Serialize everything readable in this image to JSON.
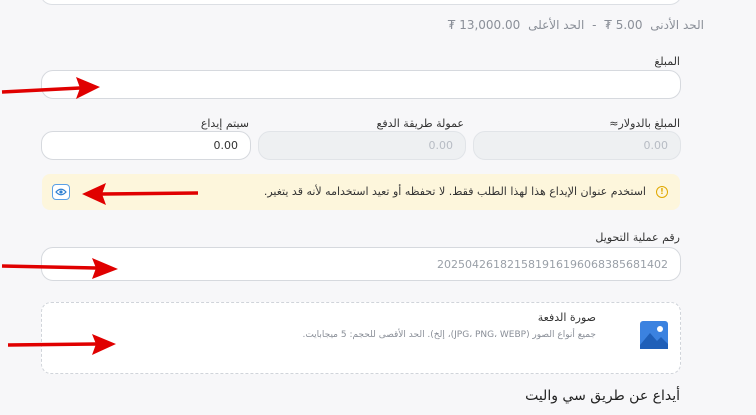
{
  "limits": {
    "min_label": "الحد الأدنى",
    "min_value": "5.00 ₮",
    "separator": "-",
    "max_label": "الحد الأعلى",
    "max_value": "13,000.00 ₮"
  },
  "amount": {
    "label": "المبلغ",
    "value": ""
  },
  "usd_amount": {
    "label": "المبلغ بالدولار≈",
    "value": "0.00"
  },
  "payment_fee": {
    "label": "عمولة طريقة الدفع",
    "value": "0.00"
  },
  "deposit_system": {
    "label": "سيتم إيداع",
    "value": "0.00"
  },
  "notice": {
    "text": "استخدم عنوان الإيداع هذا لهذا الطلب فقط. لا تحفظه أو تعيد استخدامه لأنه قد يتغير.",
    "warn_symbol": "!"
  },
  "transfer": {
    "label": "رقم عملية التحويل",
    "value": "20250426182158191619606838568140​2"
  },
  "upload": {
    "title": "صورة الدفعة",
    "description": "جميع أنواع الصور (JPG، PNG، WEBP)، إلخ). الحد الأقصى للحجم: 5 ميجابايت."
  },
  "section_title": "أيداع عن طريق سي واليت",
  "colors": {
    "arrow": "#e00000",
    "eye": "#2f80d1",
    "warn": "#e0a800",
    "image_icon": "#3b82e0"
  }
}
